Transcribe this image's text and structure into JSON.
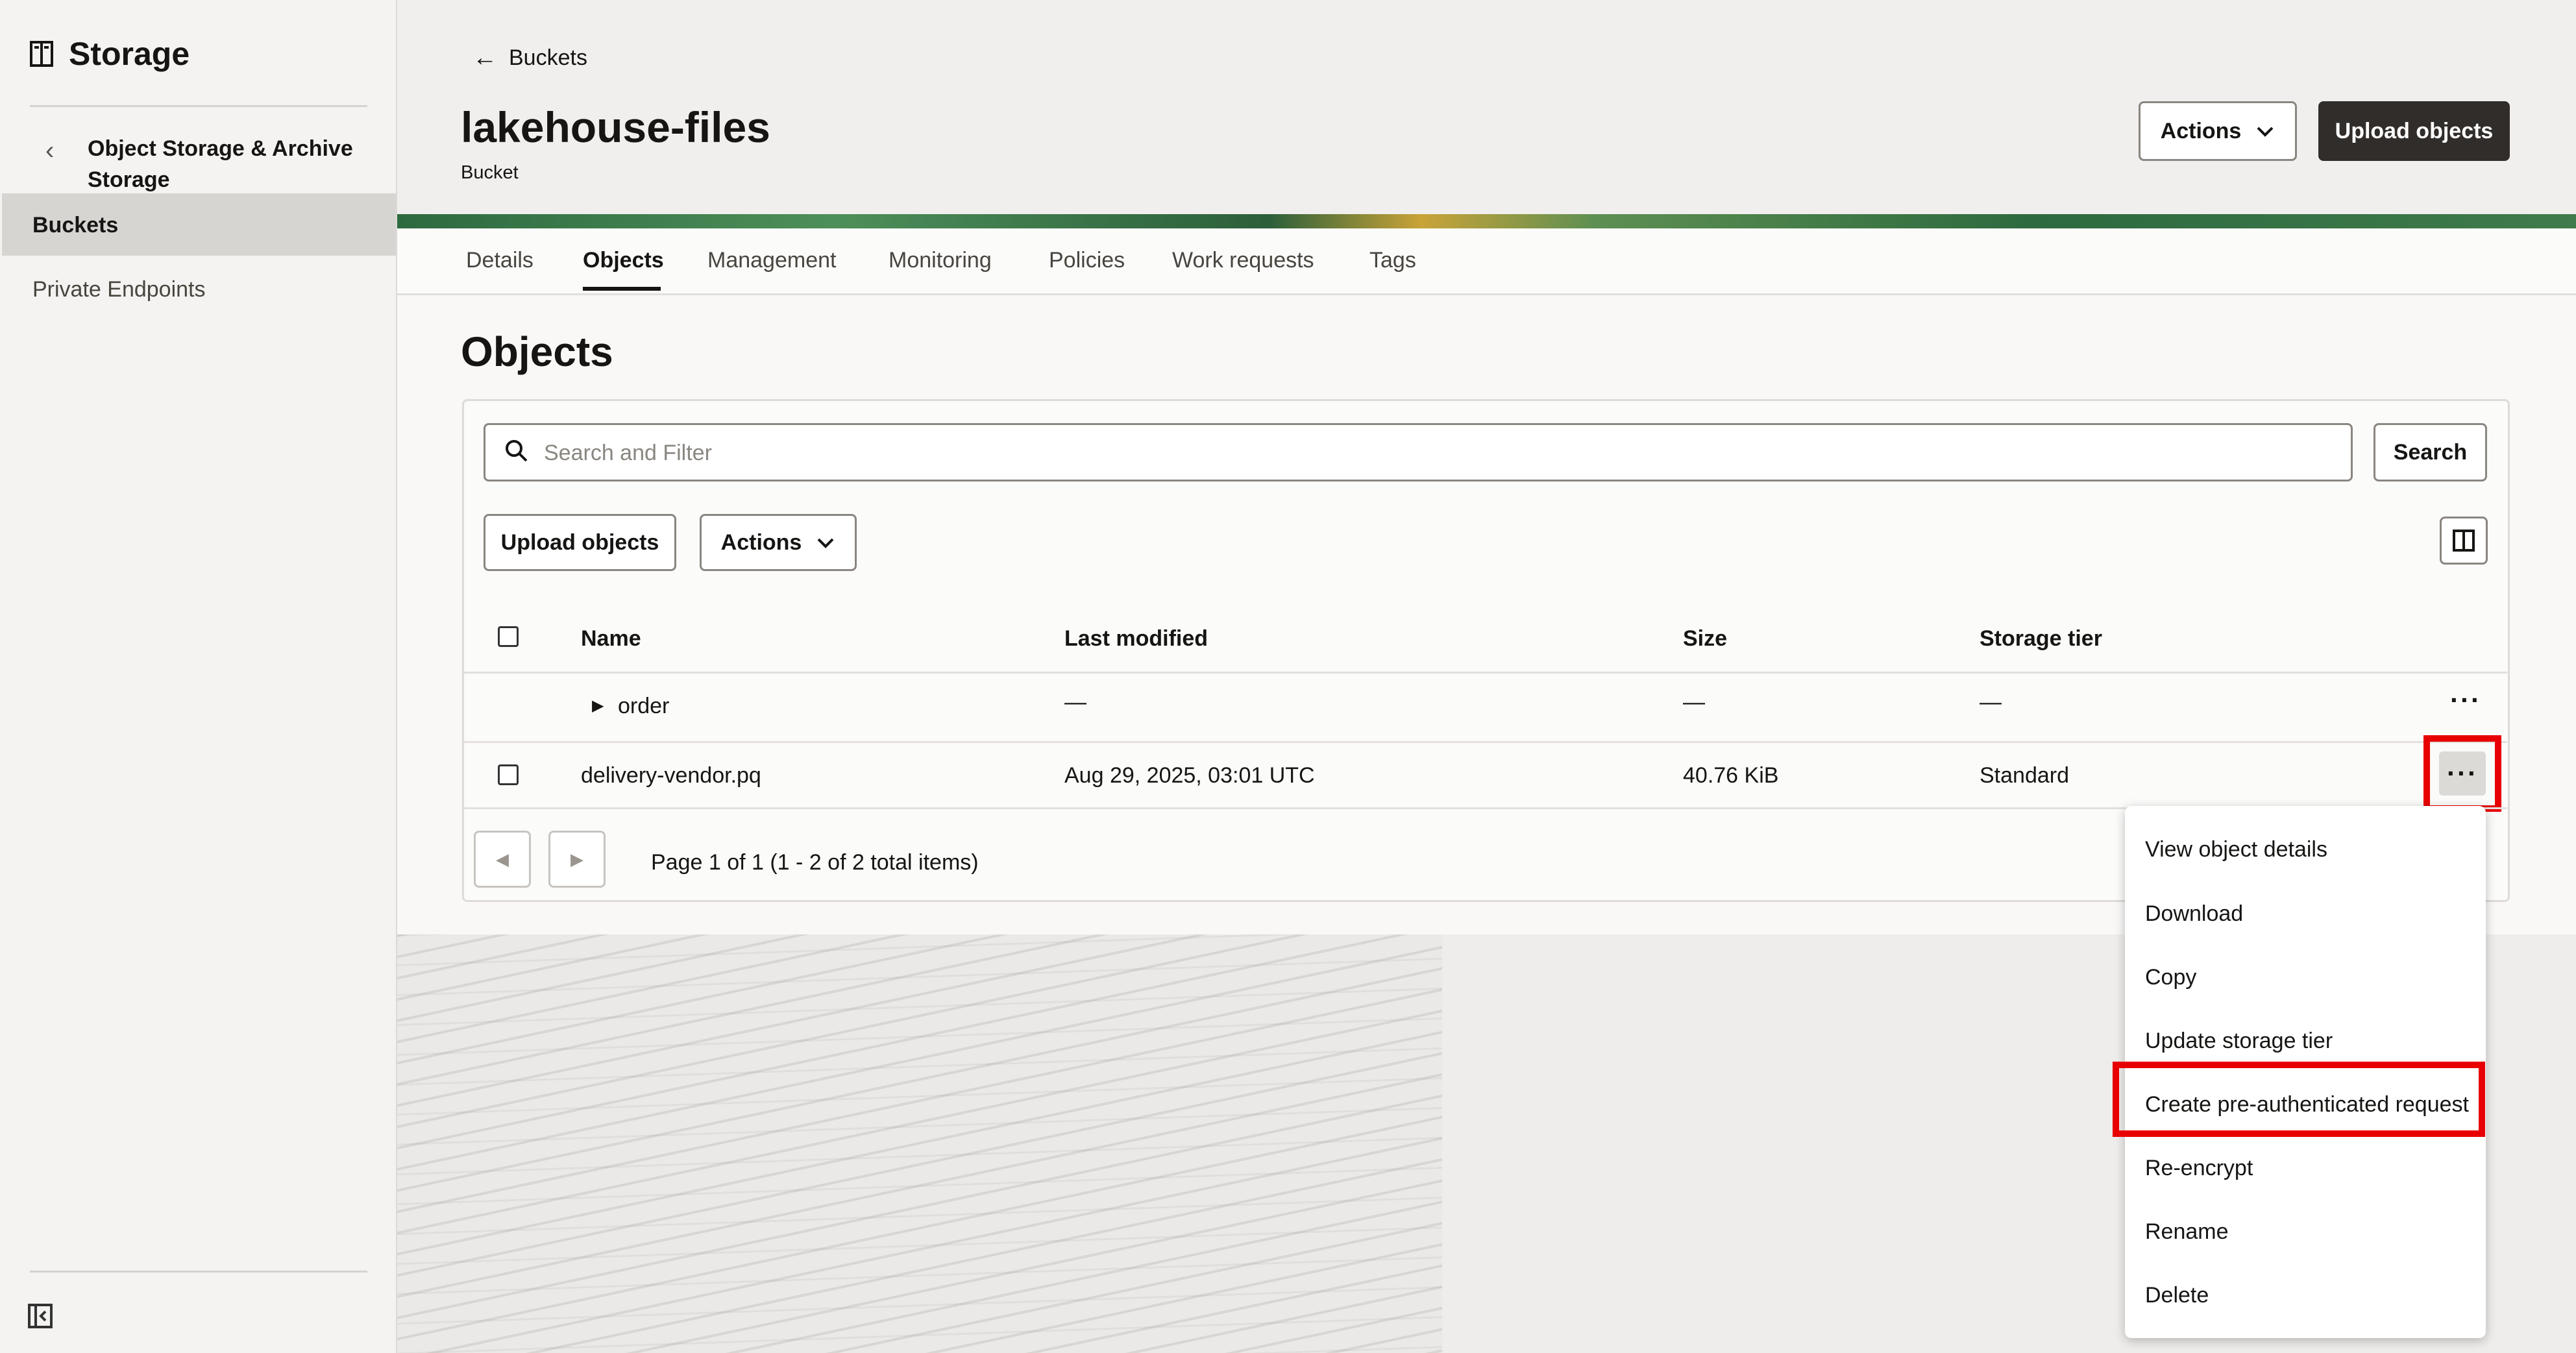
{
  "sidebar": {
    "title": "Storage",
    "section": "Object Storage & Archive Storage",
    "items": [
      {
        "label": "Buckets",
        "active": true
      },
      {
        "label": "Private Endpoints",
        "active": false
      }
    ]
  },
  "header": {
    "back_label": "Buckets",
    "bucket_name": "lakehouse-files",
    "bucket_type": "Bucket",
    "actions_label": "Actions",
    "upload_label": "Upload objects"
  },
  "tabs": [
    "Details",
    "Objects",
    "Management",
    "Monitoring",
    "Policies",
    "Work requests",
    "Tags"
  ],
  "selected_tab": "Objects",
  "objects": {
    "heading": "Objects",
    "search_placeholder": "Search and Filter",
    "search_button": "Search",
    "upload_label": "Upload objects",
    "actions_label": "Actions",
    "columns": [
      "Name",
      "Last modified",
      "Size",
      "Storage tier"
    ],
    "rows": [
      {
        "name": "order",
        "modified": "—",
        "size": "—",
        "tier": "—",
        "type": "folder"
      },
      {
        "name": "delivery-vendor.pq",
        "modified": "Aug 29, 2025, 03:01 UTC",
        "size": "40.76 KiB",
        "tier": "Standard",
        "type": "file"
      }
    ],
    "pagination": "Page 1 of 1 (1 - 2 of 2 total items)"
  },
  "context_menu": {
    "items": [
      "View object details",
      "Download",
      "Copy",
      "Update storage tier",
      "Create pre-authenticated request",
      "Re-encrypt",
      "Rename",
      "Delete"
    ],
    "highlighted": "Create pre-authenticated request"
  },
  "colors": {
    "primary_dark": "#312d2a",
    "highlight": "#e80000",
    "sidebar_active": "#d7d5d2"
  }
}
